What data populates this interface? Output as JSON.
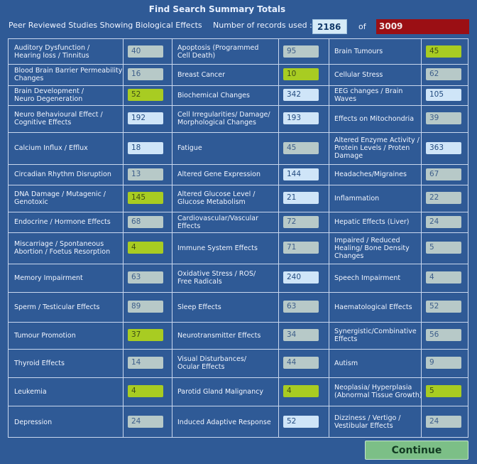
{
  "header": {
    "title": "Find Search Summary Totals",
    "subtitle": "Peer Reviewed Studies Showing Biological Effects",
    "records_label": "Number of records used :",
    "records_used": "2186",
    "of_label": "of",
    "records_total": "3009"
  },
  "rows": [
    [
      {
        "label1": "Auditory Dysfunction /",
        "label2": "Hearing loss / Tinnitus",
        "value": "40",
        "style": "gray"
      },
      {
        "label1": "Apoptosis (Programmed",
        "label2": "Cell Death)",
        "value": "95",
        "style": "gray"
      },
      {
        "label1": "Brain Tumours",
        "label2": "",
        "value": "45",
        "style": "yellow"
      }
    ],
    [
      {
        "label1": "Blood Brain Barrier Permeability",
        "label2": "Changes",
        "value": "16",
        "style": "gray"
      },
      {
        "label1": "Breast Cancer",
        "label2": "",
        "value": "10",
        "style": "yellow"
      },
      {
        "label1": "Cellular Stress",
        "label2": "",
        "value": "62",
        "style": "gray"
      }
    ],
    [
      {
        "label1": "Brain Development /",
        "label2": "Neuro Degeneration",
        "value": "52",
        "style": "yellow"
      },
      {
        "label1": "Biochemical Changes",
        "label2": "",
        "value": "342",
        "style": "blue"
      },
      {
        "label1": "EEG changes / Brain",
        "label2": "Waves",
        "value": "105",
        "style": "blue"
      }
    ],
    [
      {
        "label1": "Neuro Behavioural Effect /",
        "label2": "Cognitive Effects",
        "value": "192",
        "style": "blue"
      },
      {
        "label1": "Cell Irregularities/ Damage/",
        "label2": "Morphological Changes",
        "value": "193",
        "style": "blue"
      },
      {
        "label1": "Effects on Mitochondria",
        "label2": "",
        "value": "39",
        "style": "gray"
      }
    ],
    [
      {
        "label1": "Calcium Influx / Efflux",
        "label2": "",
        "value": "18",
        "style": "blue"
      },
      {
        "label1": "Fatigue",
        "label2": "",
        "value": "45",
        "style": "gray"
      },
      {
        "label1": "Altered Enzyme Activity /",
        "label2": "Protein Levels / Proten",
        "label3": "Damage",
        "value": "363",
        "style": "blue"
      }
    ],
    [
      {
        "label1": "Circadian Rhythm Disruption",
        "label2": "",
        "value": "13",
        "style": "gray"
      },
      {
        "label1": "Altered Gene Expression",
        "label2": "",
        "value": "144",
        "style": "blue"
      },
      {
        "label1": "Headaches/Migraines",
        "label2": "",
        "value": "67",
        "style": "gray"
      }
    ],
    [
      {
        "label1": "DNA Damage / Mutagenic /",
        "label2": "Genotoxic",
        "value": "145",
        "style": "yellow"
      },
      {
        "label1": "Altered Glucose Level /",
        "label2": "Glucose Metabolism",
        "value": "21",
        "style": "blue"
      },
      {
        "label1": "Inflammation",
        "label2": "",
        "value": "22",
        "style": "gray"
      }
    ],
    [
      {
        "label1": "Endocrine / Hormone Effects",
        "label2": "",
        "value": "68",
        "style": "gray"
      },
      {
        "label1": "Cardiovascular/Vascular",
        "label2": "Effects",
        "value": "72",
        "style": "gray"
      },
      {
        "label1": "Hepatic Effects (Liver)",
        "label2": "",
        "value": "24",
        "style": "gray"
      }
    ],
    [
      {
        "label1": "Miscarriage / Spontaneous",
        "label2": "Abortion / Foetus Resorption",
        "value": "4",
        "style": "yellow"
      },
      {
        "label1": "Immune System Effects",
        "label2": "",
        "value": "71",
        "style": "gray"
      },
      {
        "label1": "Impaired / Reduced",
        "label2": "Healing/ Bone Density",
        "label3": "Changes",
        "value": "5",
        "style": "gray"
      }
    ],
    [
      {
        "label1": "Memory Impairment",
        "label2": "",
        "value": "63",
        "style": "gray"
      },
      {
        "label1": "Oxidative Stress / ROS/",
        "label2": "Free Radicals",
        "value": "240",
        "style": "blue"
      },
      {
        "label1": "Speech Impairment",
        "label2": "",
        "value": "4",
        "style": "gray"
      }
    ],
    [
      {
        "label1": "Sperm / Testicular Effects",
        "label2": "",
        "value": "89",
        "style": "gray"
      },
      {
        "label1": "Sleep Effects",
        "label2": "",
        "value": "63",
        "style": "gray"
      },
      {
        "label1": "Haematological Effects",
        "label2": "",
        "value": "52",
        "style": "gray"
      }
    ],
    [
      {
        "label1": "Tumour Promotion",
        "label2": "",
        "value": "37",
        "style": "yellow"
      },
      {
        "label1": "Neurotransmitter Effects",
        "label2": "",
        "value": "34",
        "style": "gray"
      },
      {
        "label1": "Synergistic/Combinative",
        "label2": "Effects",
        "value": "56",
        "style": "gray"
      }
    ],
    [
      {
        "label1": "Thyroid Effects",
        "label2": "",
        "value": "14",
        "style": "gray"
      },
      {
        "label1": "Visual Disturbances/",
        "label2": "Ocular Effects",
        "value": "44",
        "style": "gray"
      },
      {
        "label1": "Autism",
        "label2": "",
        "value": "9",
        "style": "gray"
      }
    ],
    [
      {
        "label1": "Leukemia",
        "label2": "",
        "value": "4",
        "style": "yellow"
      },
      {
        "label1": "Parotid Gland Malignancy",
        "label2": "",
        "value": "4",
        "style": "yellow"
      },
      {
        "label1": "Neoplasia/ Hyperplasia",
        "label2": "(Abnormal Tissue Growth)",
        "value": "5",
        "style": "yellow"
      }
    ],
    [
      {
        "label1": "Depression",
        "label2": "",
        "value": "24",
        "style": "gray"
      },
      {
        "label1": "Induced Adaptive Response",
        "label2": "",
        "value": "52",
        "style": "blue"
      },
      {
        "label1": "Dizziness / Vertigo /",
        "label2": "Vestibular Effects",
        "value": "24",
        "style": "gray"
      }
    ]
  ],
  "footer": {
    "continue_label": "Continue"
  }
}
